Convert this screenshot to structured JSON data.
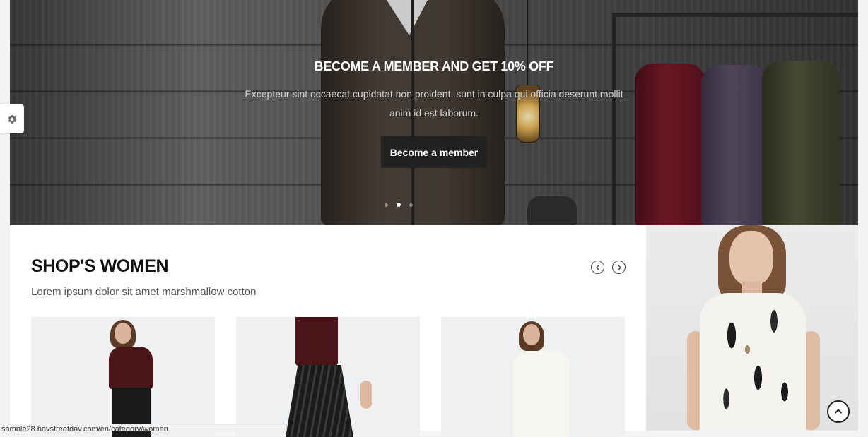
{
  "hero": {
    "title": "BECOME A MEMBER AND GET 10% OFF",
    "text_line1": "Excepteur sint occaecat cupidatat non proident, sunt in culpa qui officia deserunt mollit",
    "text_line2": "anim id est laborum.",
    "button_label": "Become a member",
    "slide_count": 3,
    "active_slide": 2
  },
  "settings": {
    "icon": "gear-icon"
  },
  "shop": {
    "title": "SHOP'S WOMEN",
    "subtitle": "Lorem ipsum dolor sit amet marshmallow cotton",
    "prev_icon": "chevron-left-icon",
    "next_icon": "chevron-right-icon"
  },
  "scroll_top": {
    "icon": "chevron-up-icon"
  },
  "status_bar": {
    "url": "sample28.boystreetday.com/en/category/women"
  },
  "colors": {
    "button_bg": "#222222",
    "section_bg": "#ffffff",
    "page_bg": "#f4f4f4"
  }
}
